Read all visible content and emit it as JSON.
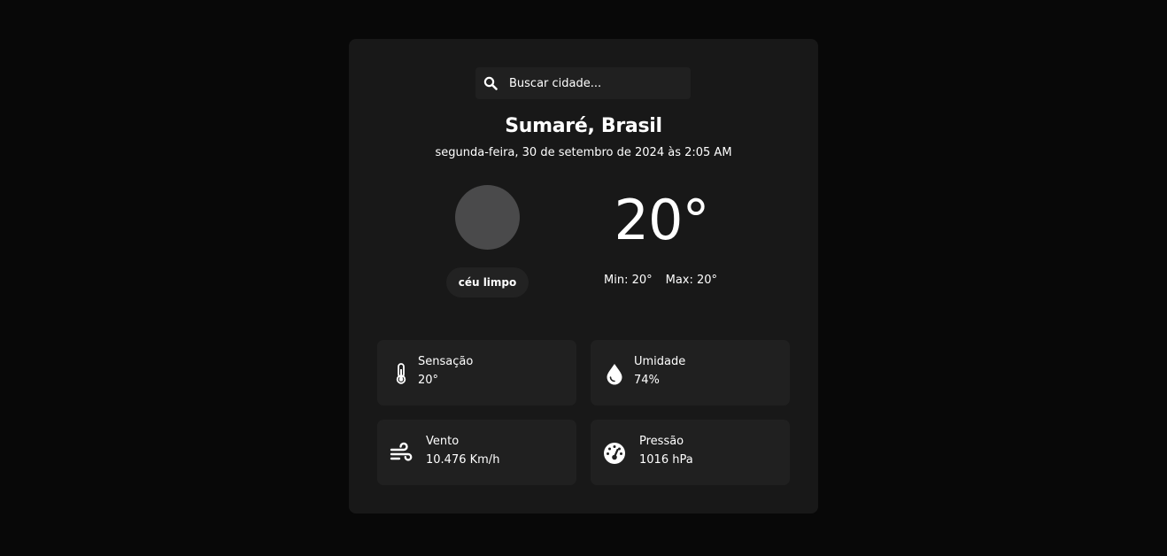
{
  "search": {
    "placeholder": "Buscar cidade..."
  },
  "location": {
    "city_line": "Sumaré, Brasil"
  },
  "datetime_text": "segunda-feira, 30 de setembro de 2024 às 2:05 AM",
  "weather": {
    "description": "céu limpo",
    "temperature": "20°",
    "min_text": "Min: 20°",
    "max_text": "Max: 20°",
    "icon": "weather-icon-placeholder"
  },
  "details": {
    "feels_like": {
      "label": "Sensação",
      "value": "20°",
      "icon": "thermometer-icon"
    },
    "humidity": {
      "label": "Umidade",
      "value": "74%",
      "icon": "water-drop-icon"
    },
    "wind": {
      "label": "Vento",
      "value": "10.476 Km/h",
      "icon": "wind-icon"
    },
    "pressure": {
      "label": "Pressão",
      "value": "1016 hPa",
      "icon": "gauge-icon"
    }
  },
  "colors": {
    "page_background": "#080808",
    "card_background": "#181818",
    "tile_background": "#202020",
    "icon_placeholder": "#4a4a4b",
    "text": "#ffffff"
  }
}
